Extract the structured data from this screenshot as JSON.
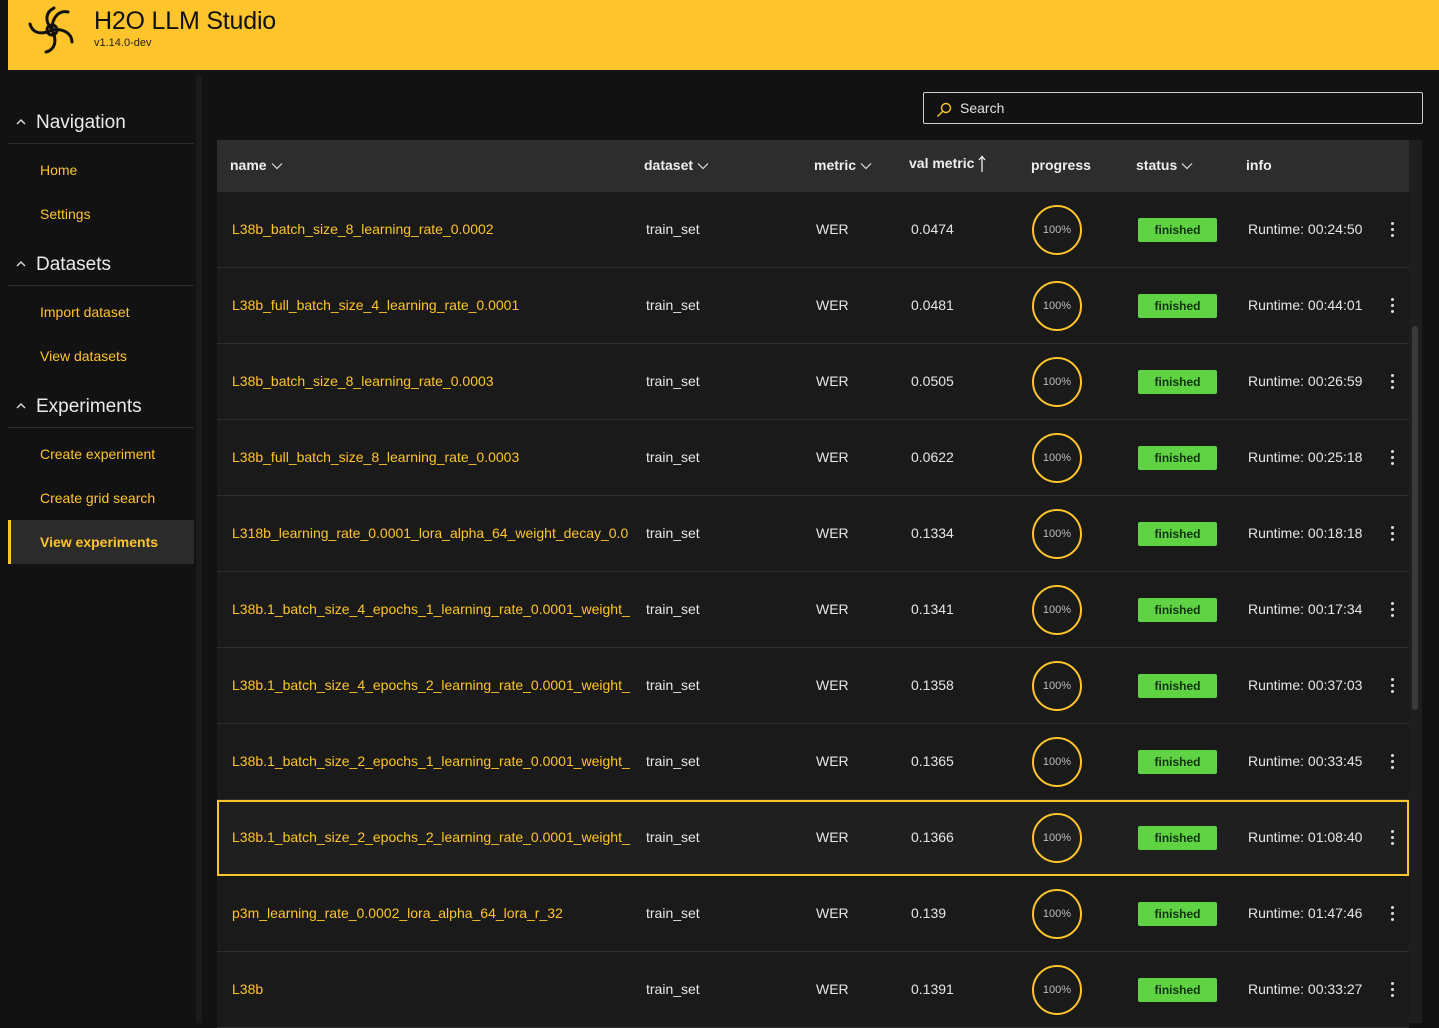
{
  "app": {
    "title": "H2O LLM Studio",
    "version": "v1.14.0-dev"
  },
  "sidebar": {
    "groups": [
      {
        "label": "Navigation",
        "items": [
          {
            "label": "Home"
          },
          {
            "label": "Settings"
          }
        ]
      },
      {
        "label": "Datasets",
        "items": [
          {
            "label": "Import dataset"
          },
          {
            "label": "View datasets"
          }
        ]
      },
      {
        "label": "Experiments",
        "items": [
          {
            "label": "Create experiment"
          },
          {
            "label": "Create grid search"
          },
          {
            "label": "View experiments",
            "active": true
          }
        ]
      }
    ]
  },
  "search": {
    "placeholder": "Search",
    "value": ""
  },
  "table": {
    "columns": {
      "name": "name",
      "dataset": "dataset",
      "metric": "metric",
      "val_metric": "val metric",
      "progress": "progress",
      "status": "status",
      "info": "info"
    },
    "sort": {
      "column": "val metric",
      "direction": "ascending"
    },
    "rows": [
      {
        "name": "L38b_batch_size_8_learning_rate_0.0002",
        "dataset": "train_set",
        "metric": "WER",
        "val_metric": "0.0474",
        "progress": "100%",
        "status": "finished",
        "info": "Runtime: 00:24:50"
      },
      {
        "name": "L38b_full_batch_size_4_learning_rate_0.0001",
        "dataset": "train_set",
        "metric": "WER",
        "val_metric": "0.0481",
        "progress": "100%",
        "status": "finished",
        "info": "Runtime: 00:44:01"
      },
      {
        "name": "L38b_batch_size_8_learning_rate_0.0003",
        "dataset": "train_set",
        "metric": "WER",
        "val_metric": "0.0505",
        "progress": "100%",
        "status": "finished",
        "info": "Runtime: 00:26:59"
      },
      {
        "name": "L38b_full_batch_size_8_learning_rate_0.0003",
        "dataset": "train_set",
        "metric": "WER",
        "val_metric": "0.0622",
        "progress": "100%",
        "status": "finished",
        "info": "Runtime: 00:25:18"
      },
      {
        "name": "L318b_learning_rate_0.0001_lora_alpha_64_weight_decay_0.0",
        "dataset": "train_set",
        "metric": "WER",
        "val_metric": "0.1334",
        "progress": "100%",
        "status": "finished",
        "info": "Runtime: 00:18:18"
      },
      {
        "name": "L38b.1_batch_size_4_epochs_1_learning_rate_0.0001_weight_",
        "dataset": "train_set",
        "metric": "WER",
        "val_metric": "0.1341",
        "progress": "100%",
        "status": "finished",
        "info": "Runtime: 00:17:34"
      },
      {
        "name": "L38b.1_batch_size_4_epochs_2_learning_rate_0.0001_weight_",
        "dataset": "train_set",
        "metric": "WER",
        "val_metric": "0.1358",
        "progress": "100%",
        "status": "finished",
        "info": "Runtime: 00:37:03"
      },
      {
        "name": "L38b.1_batch_size_2_epochs_1_learning_rate_0.0001_weight_",
        "dataset": "train_set",
        "metric": "WER",
        "val_metric": "0.1365",
        "progress": "100%",
        "status": "finished",
        "info": "Runtime: 00:33:45"
      },
      {
        "name": "L38b.1_batch_size_2_epochs_2_learning_rate_0.0001_weight_",
        "dataset": "train_set",
        "metric": "WER",
        "val_metric": "0.1366",
        "progress": "100%",
        "status": "finished",
        "info": "Runtime: 01:08:40",
        "selected": true
      },
      {
        "name": "p3m_learning_rate_0.0002_lora_alpha_64_lora_r_32",
        "dataset": "train_set",
        "metric": "WER",
        "val_metric": "0.139",
        "progress": "100%",
        "status": "finished",
        "info": "Runtime: 01:47:46"
      },
      {
        "name": "L38b",
        "dataset": "train_set",
        "metric": "WER",
        "val_metric": "0.1391",
        "progress": "100%",
        "status": "finished",
        "info": "Runtime: 00:33:27"
      }
    ]
  },
  "colors": {
    "accent": "#fec42b",
    "status_finished": "#5fd343",
    "background": "#121212",
    "row": "#1a1a1a",
    "header_row": "#2d2d2d"
  },
  "icons": {
    "logo": "h2o-logo-icon",
    "search": "search-icon",
    "sort": "sort-arrow-up-icon",
    "chevron": "chevron-down-icon",
    "group_toggle": "chevron-up-icon",
    "row_menu": "more-vertical-icon"
  }
}
